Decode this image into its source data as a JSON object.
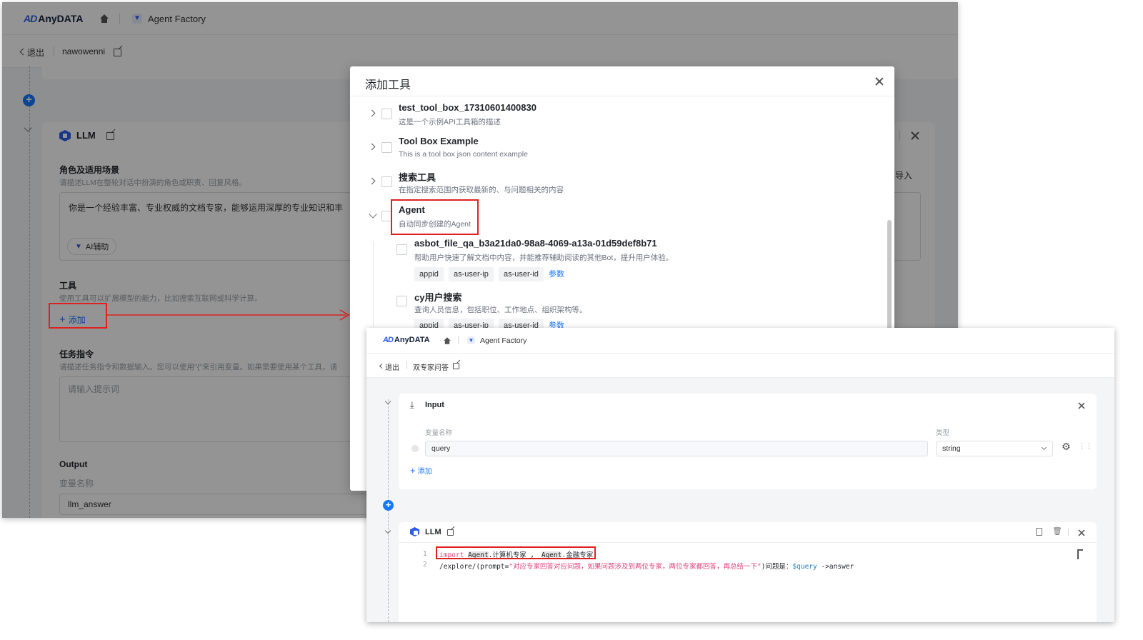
{
  "bg": {
    "brand": "AnyDATA",
    "brand_mark": "AD",
    "app_name": "Agent Factory",
    "back_label": "退出",
    "agent_name": "nawowenni",
    "llm_title": "LLM",
    "import_label": "导入",
    "role_title": "角色及适用场景",
    "role_hint": "请描述LLM在整轮对话中扮演的角色或职责、回复风格。",
    "role_text": "你是一个经验丰富、专业权威的文档专家，能够运用深厚的专业知识和丰",
    "ai_assist": "AI辅助",
    "tools_title": "工具",
    "tools_hint": "使用工具可以扩展模型的能力，比如搜索互联网或科学计算。",
    "add_tool": "添加",
    "task_title": "任务指令",
    "task_hint": "请描述任务指令和数据输入。您可以使用\"{\"来引用变量。如果需要使用某个工具，请",
    "task_placeholder": "请输入提示词",
    "output_title": "Output",
    "var_name_label": "变量名称",
    "output_value": "llm_answer"
  },
  "modal": {
    "title": "添加工具",
    "tools": [
      {
        "name": "test_tool_box_17310601400830",
        "desc": "这是一个示例API工具箱的描述"
      },
      {
        "name": "Tool Box Example",
        "desc": "This is a tool box json content example"
      },
      {
        "name": "搜索工具",
        "desc": "在指定搜索范围内获取最新的、与问题相关的内容"
      },
      {
        "name": "Agent",
        "desc": "自动同步创建的Agent"
      }
    ],
    "subtools": [
      {
        "name": "asbot_file_qa_b3a21da0-98a8-4069-a13a-01d59def8b71",
        "desc": "帮助用户快速了解文档中内容，并能推荐辅助阅读的其他Bot，提升用户体验。",
        "tags": [
          "appid",
          "as-user-ip",
          "as-user-id"
        ],
        "link": "参数"
      },
      {
        "name": "cy用户搜索",
        "desc": "查询人员信息，包括职位、工作地点、组织架构等。",
        "tags": [
          "appid",
          "as-user-ip",
          "as-user-id"
        ],
        "link": "参数"
      }
    ]
  },
  "win2": {
    "brand": "AnyDATA",
    "brand_mark": "AD",
    "app_name": "Agent Factory",
    "back_label": "退出",
    "agent_name": "双专家问答",
    "input_title": "Input",
    "var_name_label": "变量名称",
    "type_label": "类型",
    "var_value": "query",
    "type_value": "string",
    "add_label": "添加",
    "llm_title": "LLM",
    "code_line_1_no": "1",
    "code_line_2_no": "2",
    "code_1_kw": "import",
    "code_1_a": "Agent",
    "code_1_b": ".计算机专家 ，",
    "code_1_c": "Agent",
    "code_1_d": ".金融专家",
    "code_2_a": "/explore/(prompt=",
    "code_2_str": "\"对应专家回答对应问题，如果问题涉及到两位专家，两位专家都回答，再总结一下\"",
    "code_2_b": ")问题是：",
    "code_2_var": "$query",
    "code_2_c": " ->answer"
  },
  "colors": {
    "accent": "#1677ff",
    "annotation_red": "#e02020",
    "brand_blue": "#2f5ee8"
  }
}
